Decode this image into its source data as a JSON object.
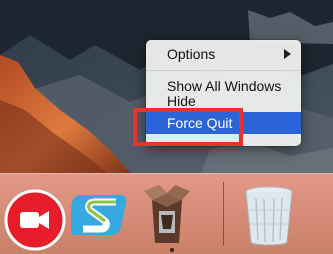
{
  "context_menu": {
    "items": [
      {
        "label": "Options",
        "has_submenu": true
      },
      {
        "label": "Show All Windows"
      },
      {
        "label": "Hide"
      },
      {
        "label": "Force Quit",
        "selected": true
      }
    ]
  },
  "dock": {
    "apps": [
      {
        "icon": "facetime-icon"
      },
      {
        "icon": "s-app-icon"
      },
      {
        "icon": "box-app-icon",
        "running": true
      },
      {
        "icon": "trash-icon"
      }
    ]
  },
  "colors": {
    "menu_highlight": "#2c64d8",
    "annotation_box": "#e0362f",
    "dock_background": "#d98a78"
  }
}
